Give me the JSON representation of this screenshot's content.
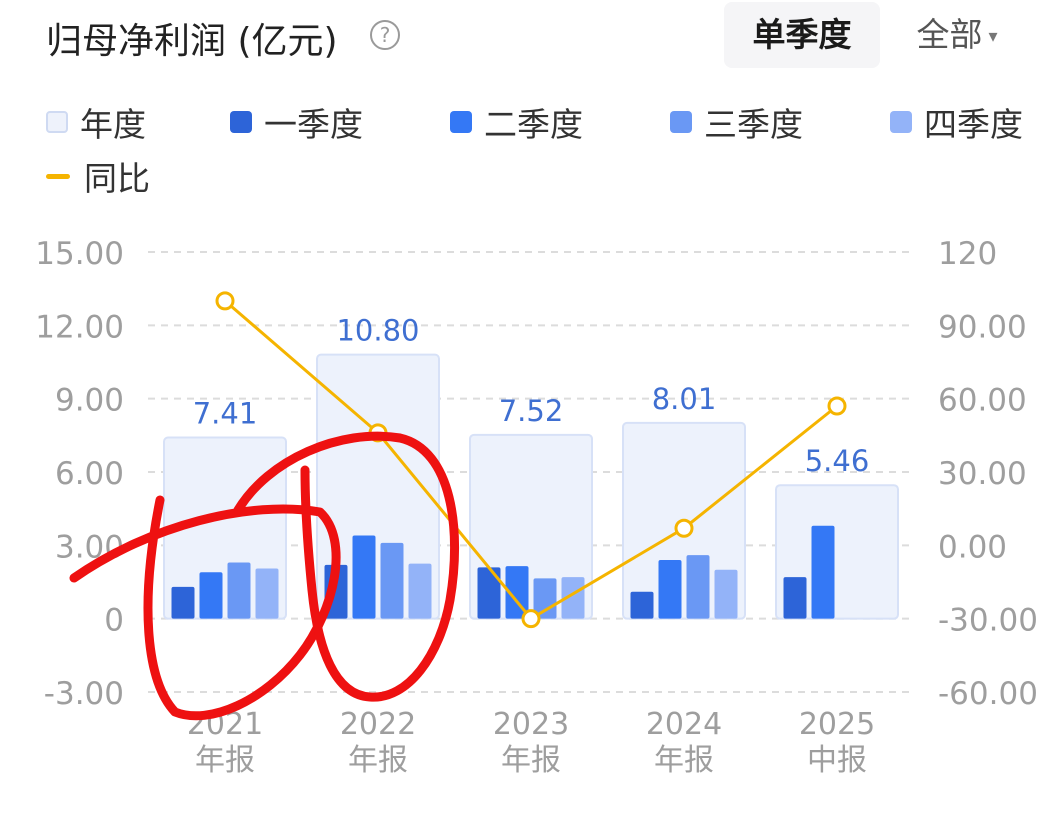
{
  "header": {
    "title": "归母净利润 (亿元)",
    "help_glyph": "?",
    "toggle_active": "单季度",
    "toggle_all": "全部",
    "caret": "▾"
  },
  "legend": [
    {
      "label": "年度",
      "color": "#e9eefb"
    },
    {
      "label": "一季度",
      "color": "#2d64d8"
    },
    {
      "label": "二季度",
      "color": "#3478f5"
    },
    {
      "label": "三季度",
      "color": "#6a98f4"
    },
    {
      "label": "四季度",
      "color": "#93b3f8"
    },
    {
      "label": "同比",
      "color": "#f5b400"
    }
  ],
  "chart_data": {
    "type": "bar",
    "categories": [
      [
        "2021",
        "年报"
      ],
      [
        "2022",
        "年报"
      ],
      [
        "2023",
        "年报"
      ],
      [
        "2024",
        "年报"
      ],
      [
        "2025",
        "中报"
      ]
    ],
    "annual": {
      "name": "年度",
      "values": [
        7.41,
        10.8,
        7.52,
        8.01,
        5.46
      ],
      "labels": [
        "7.41",
        "10.80",
        "7.52",
        "8.01",
        "5.46"
      ]
    },
    "series": [
      {
        "name": "一季度",
        "values": [
          1.3,
          2.2,
          2.1,
          1.1,
          1.7
        ]
      },
      {
        "name": "二季度",
        "values": [
          1.9,
          3.4,
          2.15,
          2.4,
          3.8
        ]
      },
      {
        "name": "三季度",
        "values": [
          2.3,
          3.1,
          1.65,
          2.6,
          null
        ]
      },
      {
        "name": "四季度",
        "values": [
          2.05,
          2.25,
          1.7,
          2.0,
          null
        ]
      }
    ],
    "yoy": {
      "name": "同比",
      "values": [
        100,
        46,
        -30,
        7,
        57
      ]
    },
    "y_left": {
      "ticks": [
        "15.00",
        "12.00",
        "9.00",
        "6.00",
        "3.00",
        "0",
        "-3.00"
      ],
      "lim": [
        -3,
        15
      ]
    },
    "y_right": {
      "ticks": [
        "120",
        "90.00",
        "60.00",
        "30.00",
        "0.00",
        "-30.00",
        "-60.00"
      ],
      "lim": [
        -60,
        120
      ]
    },
    "grid": true,
    "legend_position": "top"
  },
  "colors": {
    "annual_fill": "#edf2fc",
    "annual_stroke": "#d7e1f7",
    "annual_label": "#3f6fd1",
    "yoy": "#f5b400",
    "grid": "#dcdcdc",
    "axis_text": "#9e9e9e",
    "annotation": "#ee1111"
  }
}
